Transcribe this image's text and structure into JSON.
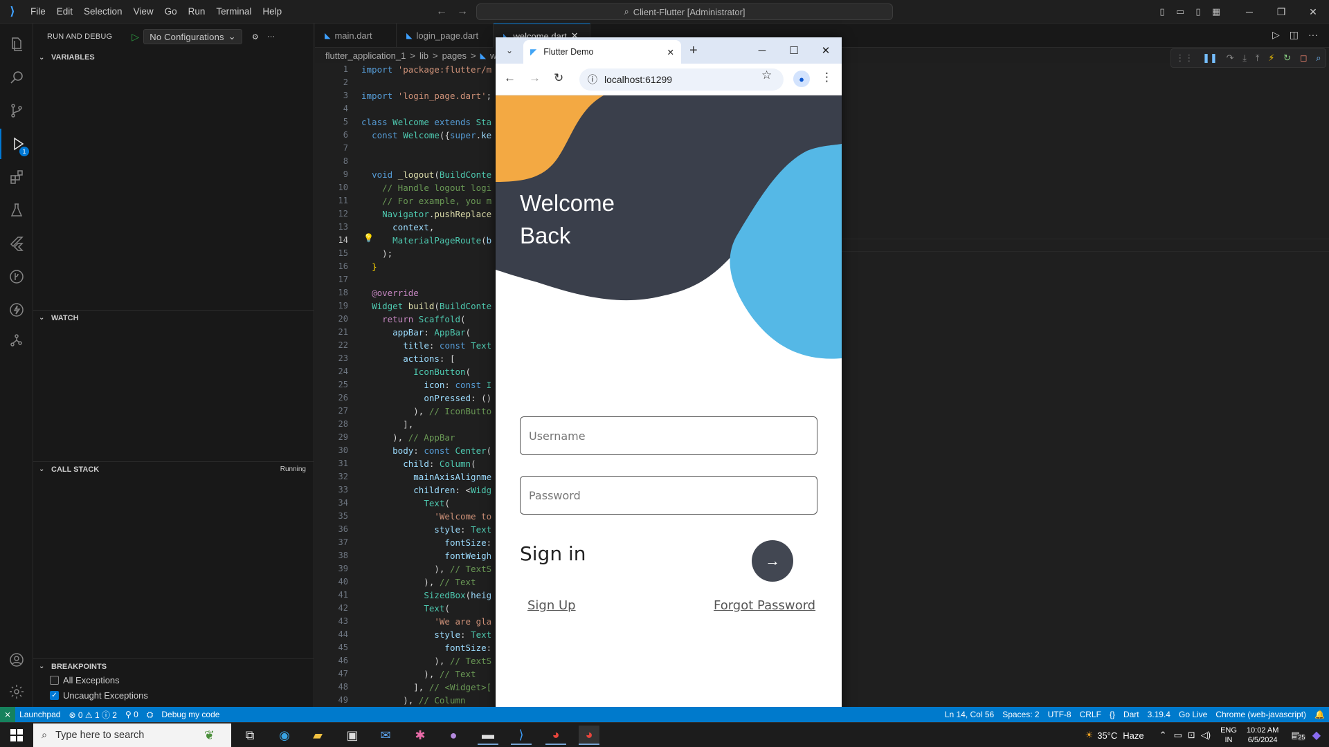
{
  "titlebar": {
    "logo": "VS Code",
    "menu": [
      "File",
      "Edit",
      "Selection",
      "View",
      "Go",
      "Run",
      "Terminal",
      "Help"
    ],
    "command_center": "Client-Flutter [Administrator]"
  },
  "sidebar": {
    "title": "RUN AND DEBUG",
    "config": "No Configurations",
    "sections": {
      "variables": "VARIABLES",
      "watch": "WATCH",
      "call_stack": "CALL STACK",
      "call_stack_status": "Running",
      "breakpoints": "BREAKPOINTS"
    },
    "breakpoints": [
      {
        "label": "All Exceptions",
        "checked": false
      },
      {
        "label": "Uncaught Exceptions",
        "checked": true
      }
    ]
  },
  "tabs": [
    {
      "label": "main.dart"
    },
    {
      "label": "login_page.dart"
    },
    {
      "label": "welcome.dart"
    }
  ],
  "breadcrumb": [
    "flutter_application_1",
    ">",
    "lib",
    ">",
    "pages",
    ">",
    "we"
  ],
  "activity_badge": "1",
  "code_lines": [
    "1",
    "2",
    "3",
    "4",
    "5",
    "6",
    "7",
    "8",
    "9",
    "10",
    "11",
    "12",
    "13",
    "14",
    "15",
    "16",
    "17",
    "18",
    "19",
    "20",
    "21",
    "22",
    "23",
    "24",
    "25",
    "26",
    "27",
    "28",
    "29",
    "30",
    "31",
    "32",
    "33",
    "34",
    "35",
    "36",
    "37",
    "38",
    "39",
    "40",
    "41",
    "42",
    "43",
    "44",
    "45",
    "46",
    "47",
    "48",
    "49"
  ],
  "current_line": "14",
  "statusbar": {
    "remote": "⨯",
    "launchpad": "Launchpad",
    "problems": "⊗ 0 ⚠ 1 ⓘ 2",
    "ports": "⚲ 0",
    "debug": "Debug my code",
    "position": "Ln 14, Col 56",
    "spaces": "Spaces: 2",
    "encoding": "UTF-8",
    "eol": "CRLF",
    "language": "Dart",
    "sdk": "3.19.4",
    "golive": "Go Live",
    "device": "Chrome (web-javascript)"
  },
  "browser": {
    "tab_title": "Flutter Demo",
    "url": "localhost:61299"
  },
  "app": {
    "heading_line1": "Welcome",
    "heading_line2": "Back",
    "username_placeholder": "Username",
    "password_placeholder": "Password",
    "signin": "Sign in",
    "signup": "Sign Up",
    "forgot": "Forgot Password"
  },
  "taskbar": {
    "search_placeholder": "Type here to search",
    "weather_temp": "35°C",
    "weather_text": "Haze",
    "lang1": "ENG",
    "lang2": "IN",
    "time": "10:02 AM",
    "date": "6/5/2024",
    "notif": "25"
  }
}
